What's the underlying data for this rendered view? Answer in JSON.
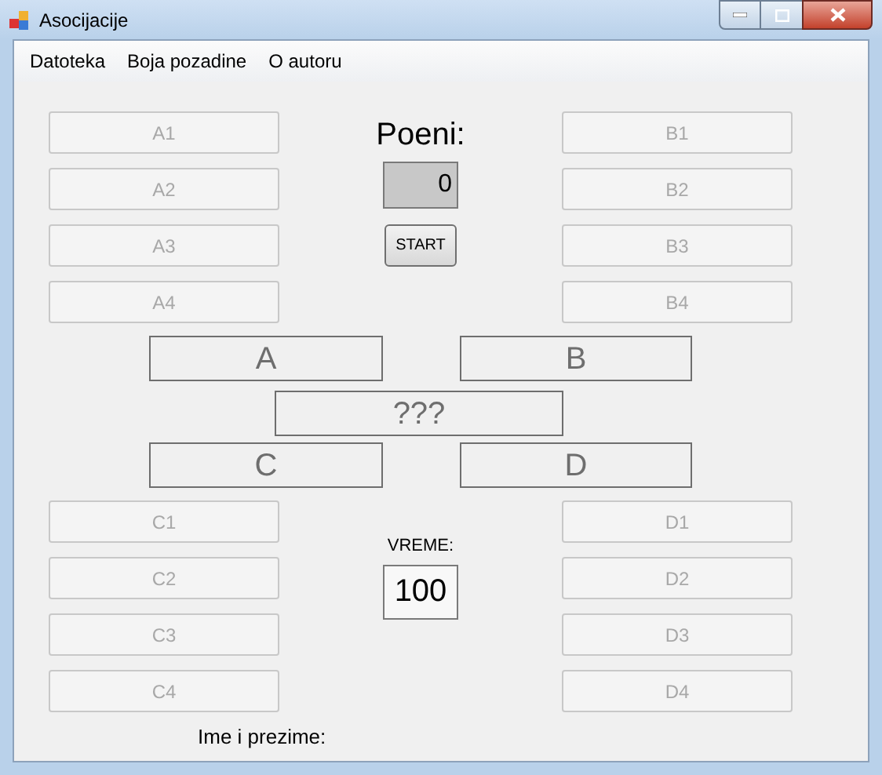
{
  "window": {
    "title": "Asocijacije"
  },
  "menu": [
    "Datoteka",
    "Boja pozadine",
    "O autoru"
  ],
  "score": {
    "label": "Poeni:",
    "value": "0"
  },
  "start_button": {
    "label": "START"
  },
  "timer": {
    "label": "VREME:",
    "value": "100"
  },
  "columns": {
    "a": [
      {
        "label": "A1",
        "disabled": true
      },
      {
        "label": "A2",
        "disabled": true
      },
      {
        "label": "A3",
        "disabled": true
      },
      {
        "label": "A4",
        "disabled": true
      }
    ],
    "b": [
      {
        "label": "B1",
        "disabled": true
      },
      {
        "label": "B2",
        "disabled": true
      },
      {
        "label": "B3",
        "disabled": true
      },
      {
        "label": "B4",
        "disabled": true
      }
    ],
    "c": [
      {
        "label": "C1",
        "disabled": true
      },
      {
        "label": "C2",
        "disabled": true
      },
      {
        "label": "C3",
        "disabled": true
      },
      {
        "label": "C4",
        "disabled": true
      }
    ],
    "d": [
      {
        "label": "D1",
        "disabled": true
      },
      {
        "label": "D2",
        "disabled": true
      },
      {
        "label": "D3",
        "disabled": true
      },
      {
        "label": "D4",
        "disabled": true
      }
    ]
  },
  "answers": {
    "a": "A",
    "b": "B",
    "final": "???",
    "c": "C",
    "d": "D"
  },
  "player_label": "Ime i prezime:"
}
